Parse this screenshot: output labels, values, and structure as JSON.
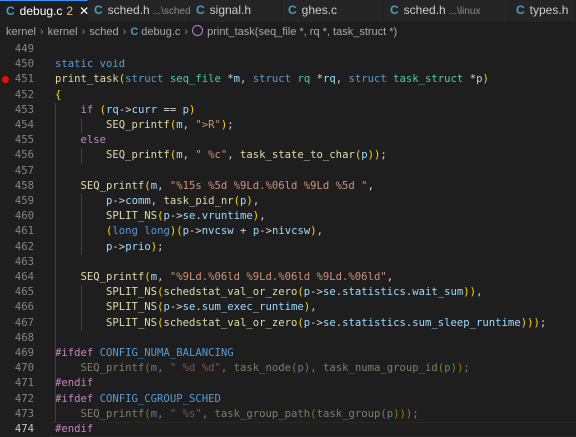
{
  "tabs": [
    {
      "label": "debug.c",
      "badge": "2",
      "path": "",
      "active": true
    },
    {
      "label": "sched.h",
      "badge": "",
      "path": "...\\sched",
      "active": false
    },
    {
      "label": "signal.h",
      "badge": "",
      "path": "",
      "active": false
    },
    {
      "label": "ghes.c",
      "badge": "",
      "path": "",
      "active": false
    },
    {
      "label": "sched.h",
      "badge": "",
      "path": "...\\linux",
      "active": false
    },
    {
      "label": "types.h",
      "badge": "",
      "path": "",
      "active": false
    }
  ],
  "tab_icon": "C",
  "breadcrumb": {
    "items": [
      "kernel",
      "kernel",
      "sched",
      "debug.c"
    ],
    "symbol": "print_task(seq_file *, rq *, task_struct *)"
  },
  "breakpoint_line": "451",
  "current_line": "474",
  "lines": [
    {
      "n": "449",
      "t": []
    },
    {
      "n": "450",
      "t": [
        [
          "k",
          "static "
        ],
        [
          "k",
          "void"
        ]
      ]
    },
    {
      "n": "451",
      "t": [
        [
          "f",
          "print_task"
        ],
        [
          "b",
          "("
        ],
        [
          "k",
          "struct "
        ],
        [
          "m",
          "seq_file "
        ],
        [
          "t",
          "*"
        ],
        [
          "v",
          "m"
        ],
        [
          "t",
          ", "
        ],
        [
          "k",
          "struct "
        ],
        [
          "m",
          "rq "
        ],
        [
          "t",
          "*"
        ],
        [
          "v",
          "rq"
        ],
        [
          "t",
          ", "
        ],
        [
          "k",
          "struct "
        ],
        [
          "m",
          "task_struct "
        ],
        [
          "t",
          "*"
        ],
        [
          "v",
          "p"
        ],
        [
          "b",
          ")"
        ]
      ]
    },
    {
      "n": "452",
      "t": [
        [
          "b",
          "{"
        ]
      ]
    },
    {
      "n": "453",
      "t": [
        [
          "t",
          "    "
        ],
        [
          "p",
          "if "
        ],
        [
          "b",
          "("
        ],
        [
          "v",
          "rq"
        ],
        [
          "t",
          "->"
        ],
        [
          "v",
          "curr "
        ],
        [
          "t",
          "== "
        ],
        [
          "v",
          "p"
        ],
        [
          "b",
          ")"
        ]
      ]
    },
    {
      "n": "454",
      "t": [
        [
          "t",
          "        "
        ],
        [
          "f",
          "SEQ_printf"
        ],
        [
          "b",
          "("
        ],
        [
          "v",
          "m"
        ],
        [
          "t",
          ", "
        ],
        [
          "s",
          "\">R\""
        ],
        [
          "b",
          ")"
        ],
        [
          "t",
          ";"
        ]
      ]
    },
    {
      "n": "455",
      "t": [
        [
          "t",
          "    "
        ],
        [
          "p",
          "else"
        ]
      ]
    },
    {
      "n": "456",
      "t": [
        [
          "t",
          "        "
        ],
        [
          "f",
          "SEQ_printf"
        ],
        [
          "b",
          "("
        ],
        [
          "v",
          "m"
        ],
        [
          "t",
          ", "
        ],
        [
          "s",
          "\" %c\""
        ],
        [
          "t",
          ", "
        ],
        [
          "f",
          "task_state_to_char"
        ],
        [
          "b",
          "("
        ],
        [
          "v",
          "p"
        ],
        [
          "b",
          "))"
        ],
        [
          "t",
          ";"
        ]
      ]
    },
    {
      "n": "457",
      "t": []
    },
    {
      "n": "458",
      "t": [
        [
          "t",
          "    "
        ],
        [
          "f",
          "SEQ_printf"
        ],
        [
          "b",
          "("
        ],
        [
          "v",
          "m"
        ],
        [
          "t",
          ", "
        ],
        [
          "s",
          "\"%15s %5d %9Ld.%06ld %9Ld %5d \""
        ],
        [
          "t",
          ","
        ]
      ]
    },
    {
      "n": "459",
      "t": [
        [
          "t",
          "        "
        ],
        [
          "v",
          "p"
        ],
        [
          "t",
          "->"
        ],
        [
          "v",
          "comm"
        ],
        [
          "t",
          ", "
        ],
        [
          "f",
          "task_pid_nr"
        ],
        [
          "b",
          "("
        ],
        [
          "v",
          "p"
        ],
        [
          "b",
          ")"
        ],
        [
          "t",
          ","
        ]
      ]
    },
    {
      "n": "460",
      "t": [
        [
          "t",
          "        "
        ],
        [
          "f",
          "SPLIT_NS"
        ],
        [
          "b",
          "("
        ],
        [
          "v",
          "p"
        ],
        [
          "t",
          "->"
        ],
        [
          "v",
          "se"
        ],
        [
          "t",
          "."
        ],
        [
          "v",
          "vruntime"
        ],
        [
          "b",
          ")"
        ],
        [
          "t",
          ","
        ]
      ]
    },
    {
      "n": "461",
      "t": [
        [
          "t",
          "        "
        ],
        [
          "b",
          "("
        ],
        [
          "k",
          "long long"
        ],
        [
          "b",
          ")"
        ],
        [
          "b",
          "("
        ],
        [
          "v",
          "p"
        ],
        [
          "t",
          "->"
        ],
        [
          "v",
          "nvcsw "
        ],
        [
          "t",
          "+ "
        ],
        [
          "v",
          "p"
        ],
        [
          "t",
          "->"
        ],
        [
          "v",
          "nivcsw"
        ],
        [
          "b",
          ")"
        ],
        [
          "t",
          ","
        ]
      ]
    },
    {
      "n": "462",
      "t": [
        [
          "t",
          "        "
        ],
        [
          "v",
          "p"
        ],
        [
          "t",
          "->"
        ],
        [
          "v",
          "prio"
        ],
        [
          "b",
          ")"
        ],
        [
          "t",
          ";"
        ]
      ]
    },
    {
      "n": "463",
      "t": []
    },
    {
      "n": "464",
      "t": [
        [
          "t",
          "    "
        ],
        [
          "f",
          "SEQ_printf"
        ],
        [
          "b",
          "("
        ],
        [
          "v",
          "m"
        ],
        [
          "t",
          ", "
        ],
        [
          "s",
          "\"%9Ld.%06ld %9Ld.%06ld %9Ld.%06ld\""
        ],
        [
          "t",
          ","
        ]
      ]
    },
    {
      "n": "465",
      "t": [
        [
          "t",
          "        "
        ],
        [
          "f",
          "SPLIT_NS"
        ],
        [
          "b",
          "("
        ],
        [
          "f",
          "schedstat_val_or_zero"
        ],
        [
          "b",
          "("
        ],
        [
          "v",
          "p"
        ],
        [
          "t",
          "->"
        ],
        [
          "v",
          "se"
        ],
        [
          "t",
          "."
        ],
        [
          "v",
          "statistics"
        ],
        [
          "t",
          "."
        ],
        [
          "v",
          "wait_sum"
        ],
        [
          "b",
          "))"
        ],
        [
          "t",
          ","
        ]
      ]
    },
    {
      "n": "466",
      "t": [
        [
          "t",
          "        "
        ],
        [
          "f",
          "SPLIT_NS"
        ],
        [
          "b",
          "("
        ],
        [
          "v",
          "p"
        ],
        [
          "t",
          "->"
        ],
        [
          "v",
          "se"
        ],
        [
          "t",
          "."
        ],
        [
          "v",
          "sum_exec_runtime"
        ],
        [
          "b",
          ")"
        ],
        [
          "t",
          ","
        ]
      ]
    },
    {
      "n": "467",
      "t": [
        [
          "t",
          "        "
        ],
        [
          "f",
          "SPLIT_NS"
        ],
        [
          "b",
          "("
        ],
        [
          "f",
          "schedstat_val_or_zero"
        ],
        [
          "b",
          "("
        ],
        [
          "v",
          "p"
        ],
        [
          "t",
          "->"
        ],
        [
          "v",
          "se"
        ],
        [
          "t",
          "."
        ],
        [
          "v",
          "statistics"
        ],
        [
          "t",
          "."
        ],
        [
          "v",
          "sum_sleep_runtime"
        ],
        [
          "b",
          ")))"
        ],
        [
          "t",
          ";"
        ]
      ]
    },
    {
      "n": "468",
      "t": []
    },
    {
      "n": "469",
      "t": [
        [
          "p",
          "#ifdef "
        ],
        [
          "k",
          "CONFIG_NUMA_BALANCING"
        ]
      ]
    },
    {
      "n": "470",
      "dim": true,
      "t": [
        [
          "t",
          "    "
        ],
        [
          "f",
          "SEQ_printf"
        ],
        [
          "b",
          "("
        ],
        [
          "v",
          "m"
        ],
        [
          "t",
          ", "
        ],
        [
          "s",
          "\" %d %d\""
        ],
        [
          "t",
          ", "
        ],
        [
          "f",
          "task_node"
        ],
        [
          "b",
          "("
        ],
        [
          "v",
          "p"
        ],
        [
          "b",
          ")"
        ],
        [
          "t",
          ", "
        ],
        [
          "f",
          "task_numa_group_id"
        ],
        [
          "b",
          "("
        ],
        [
          "v",
          "p"
        ],
        [
          "b",
          "))"
        ],
        [
          "t",
          ";"
        ]
      ]
    },
    {
      "n": "471",
      "t": [
        [
          "p",
          "#endif"
        ]
      ]
    },
    {
      "n": "472",
      "t": [
        [
          "p",
          "#ifdef "
        ],
        [
          "k",
          "CONFIG_CGROUP_SCHED"
        ]
      ]
    },
    {
      "n": "473",
      "dim": true,
      "t": [
        [
          "t",
          "    "
        ],
        [
          "f",
          "SEQ_printf"
        ],
        [
          "b",
          "("
        ],
        [
          "v",
          "m"
        ],
        [
          "t",
          ", "
        ],
        [
          "s",
          "\" %s\""
        ],
        [
          "t",
          ", "
        ],
        [
          "f",
          "task_group_path"
        ],
        [
          "b",
          "("
        ],
        [
          "f",
          "task_group"
        ],
        [
          "b",
          "("
        ],
        [
          "v",
          "p"
        ],
        [
          "b",
          ")))"
        ],
        [
          "t",
          ";"
        ]
      ]
    },
    {
      "n": "474",
      "t": [
        [
          "p",
          "#endif"
        ]
      ]
    }
  ]
}
